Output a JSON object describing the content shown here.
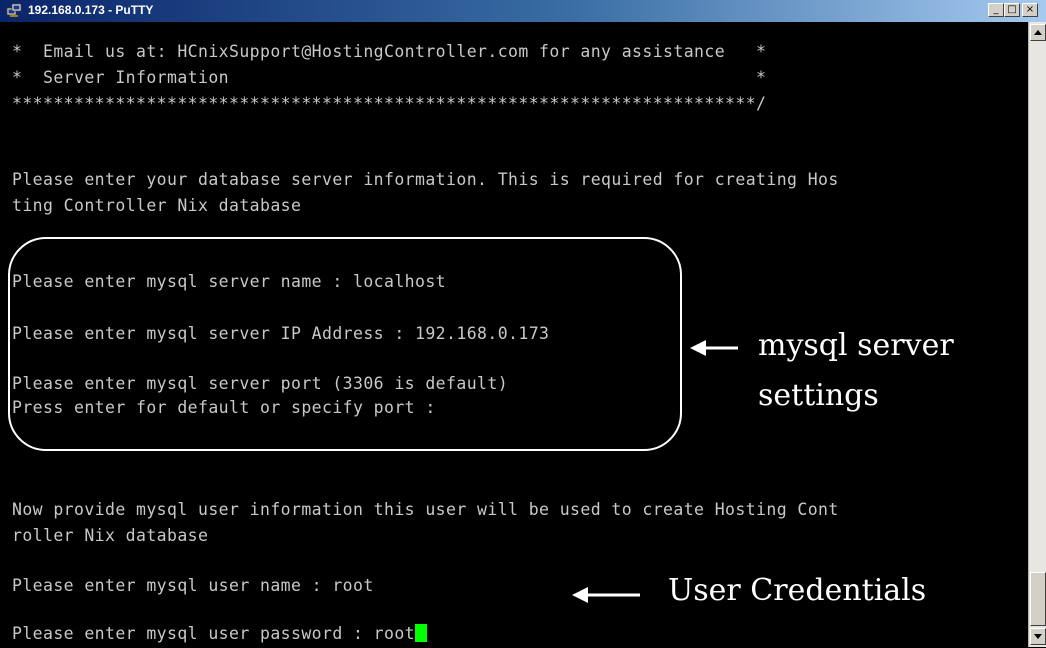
{
  "window": {
    "title": "192.168.0.173 - PuTTY"
  },
  "terminal": {
    "lines": [
      "*  Email us at: HCnixSupport@HostingController.com for any assistance   *",
      "*  Server Information                                                   *",
      "************************************************************************/",
      "Please enter your database server information. This is required for creating Hos",
      "ting Controller Nix database",
      "Please enter mysql server name : localhost",
      "Please enter mysql server IP Address : 192.168.0.173",
      "Please enter mysql server port (3306 is default)",
      "Press enter for default or specify port :",
      "Now provide mysql user information this user will be used to create Hosting Cont",
      "roller Nix database",
      "Please enter mysql user name : root",
      "Please enter mysql user password : root"
    ]
  },
  "annotations": {
    "mysql_server_line1": "mysql server",
    "mysql_server_line2": "settings",
    "user_credentials": "User Credentials"
  },
  "colors": {
    "cursor": "#00ff00",
    "terminal_bg": "#000000",
    "terminal_fg": "#c8c8c8"
  },
  "icons": {
    "app": "putty-icon",
    "minimize": "minimize-icon",
    "maximize": "maximize-icon",
    "close": "close-icon"
  }
}
